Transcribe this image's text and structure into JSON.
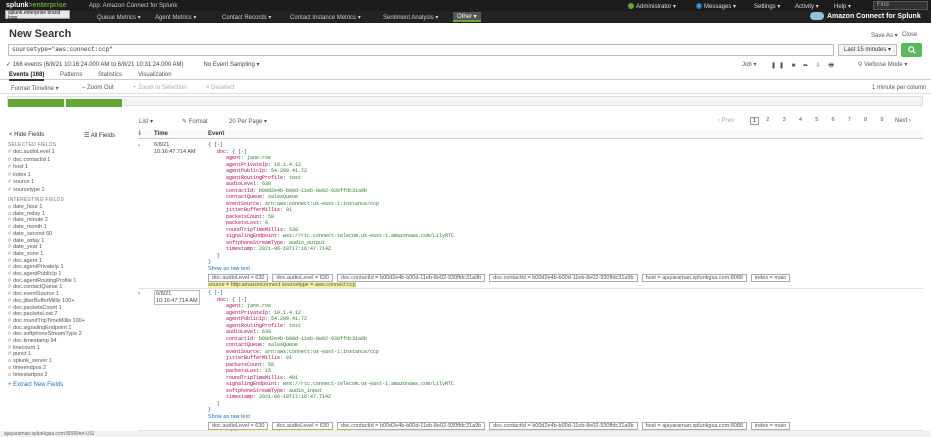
{
  "topbar": {
    "logo_main": "splunk",
    "logo_sub": ">enterprise",
    "app_title": "App: Amazon Connect for Splunk",
    "admin": "Administrator",
    "messages_count": "2",
    "messages": "Messages",
    "settings": "Settings",
    "activity": "Activity",
    "help": "Help",
    "find": "Find"
  },
  "appbar": {
    "tooltip": "splunk.enterprise brand logo",
    "nav": [
      "Queue Metrics",
      "Agent Metrics",
      "Contact Records",
      "Contact Instance Metrics",
      "Sentiment Analysis",
      "Other"
    ],
    "brand": "Amazon Connect for Splunk"
  },
  "header": {
    "title": "New Search",
    "save_as": "Save As",
    "close": "Close"
  },
  "search": {
    "query": "sourcetype=\"aws:connect:ccp\"",
    "time_range": "Last 15 minutes",
    "search_icon": "search-icon"
  },
  "status": {
    "events": "✓ 168 events (6/8/21 10:16:24.000 AM to 6/8/21 10:31:24.000 AM)",
    "sampling": "No Event Sampling",
    "job": "Job",
    "mode": "Verbose Mode"
  },
  "tabs": [
    "Events (168)",
    "Patterns",
    "Statistics",
    "Visualization"
  ],
  "timeline_bar": {
    "format": "Format Timeline",
    "zoom_out": "– Zoom Out",
    "zoom_sel": "+ Zoom to Selection",
    "deselect": "× Deselect",
    "per": "1 minute per column"
  },
  "sidebar": {
    "hide": "< Hide Fields",
    "all": "All Fields",
    "selected_header": "SELECTED FIELDS",
    "selected": [
      "doc.audioLevel 1",
      "doc.contactId 1",
      "host 1",
      "index 1",
      "source 1",
      "sourcetype 1"
    ],
    "interesting_header": "INTERESTING FIELDS",
    "interesting": [
      "date_hour 1",
      "date_mday 1",
      "date_minute 2",
      "date_month 1",
      "date_second 60",
      "date_wday 1",
      "date_year 1",
      "date_zone 1",
      "doc.agent 1",
      "doc.agentPrivateIp 1",
      "doc.agentPublicIp 1",
      "doc.agentRoutingProfile 1",
      "doc.contactQueue 1",
      "doc.eventSource 1",
      "doc.jitterBufferMillis 100+",
      "doc.packetsCount 1",
      "doc.packetsLost 7",
      "doc.roundTripTimeMillis 100+",
      "doc.signalingEndpoint 1",
      "doc.softphoneStreamType 2",
      "doc.timestamp 94",
      "linecount 1",
      "punct 1",
      "splunk_server 1",
      "timeendpos 2",
      "timestartpos 2"
    ],
    "extract": "+ Extract New Fields"
  },
  "toolbar": {
    "list": "List",
    "format": "✎ Format",
    "per_page": "20 Per Page",
    "prev": "‹ Prev",
    "pages": [
      "1",
      "2",
      "3",
      "4",
      "5",
      "6",
      "7",
      "8",
      "9"
    ],
    "next": "Next ›"
  },
  "table": {
    "col_i": "i",
    "col_time": "Time",
    "col_event": "Event"
  },
  "events": [
    {
      "date": "6/8/21",
      "time": "10:16:47.714 AM",
      "lines": [
        {
          "i": 0,
          "t": "{ [-]"
        },
        {
          "i": 1,
          "k": "doc",
          "v": "{ [-]"
        },
        {
          "i": 2,
          "k": "agent",
          "v": "jane.roe"
        },
        {
          "i": 2,
          "k": "agentPrivateIp",
          "v": "10.1.4.12"
        },
        {
          "i": 2,
          "k": "agentPublicIp",
          "v": "54.209.41.72"
        },
        {
          "i": 2,
          "k": "agentRoutingProfile",
          "v": "test"
        },
        {
          "i": 2,
          "k": "audioLevel",
          "v": "630"
        },
        {
          "i": 2,
          "k": "contactId",
          "v": "b00d2e4b-b00d-11eb-8e02-930ffdc31a9b"
        },
        {
          "i": 2,
          "k": "contactQueue",
          "v": "salesQueue"
        },
        {
          "i": 2,
          "k": "eventSource",
          "v": "arn:aws:connect:us-east-1:instance/ccp"
        },
        {
          "i": 2,
          "k": "jitterBufferMillis",
          "v": "91"
        },
        {
          "i": 2,
          "k": "packetsCount",
          "v": "50"
        },
        {
          "i": 2,
          "k": "packetsLost",
          "v": "0"
        },
        {
          "i": 2,
          "k": "roundTripTimeMillis",
          "v": "530"
        },
        {
          "i": 2,
          "k": "signalingEndpoint",
          "v": "wss://rtc.connect-telecom.us-east-1.amazonaws.com/LilyRTC"
        },
        {
          "i": 2,
          "k": "softphoneStreamType",
          "v": "audio_output"
        },
        {
          "i": 2,
          "k": "timestamp",
          "v": "2021-06-10T17:16:47.714Z"
        },
        {
          "i": 1,
          "t": "}"
        },
        {
          "i": 0,
          "t": "}"
        }
      ],
      "show_raw": "Show as raw text",
      "meta_top": [
        "doc.audioLevel = 630",
        "doc.audioLevel = 630",
        "doc.contactId = b00d2e4b-b00d-11eb-8e02-930ffdc31a9b",
        "doc.contactId = b00d2e4b-b00d-11eb-8e02-930ffdc31a9b",
        "host = ajayaraman.splunkgsa.com:8088",
        "index = main"
      ],
      "meta_bottom": "source = http:amazonconnect    sourcetype = aws:connect:ccp"
    },
    {
      "date": "6/8/21",
      "time": "10:16:47.714 AM",
      "lines": [
        {
          "i": 0,
          "t": "{ [-]"
        },
        {
          "i": 1,
          "k": "doc",
          "v": "{ [-]"
        },
        {
          "i": 2,
          "k": "agent",
          "v": "jane.roe"
        },
        {
          "i": 2,
          "k": "agentPrivateIp",
          "v": "10.1.4.12"
        },
        {
          "i": 2,
          "k": "agentPublicIp",
          "v": "54.209.41.72"
        },
        {
          "i": 2,
          "k": "agentRoutingProfile",
          "v": "test"
        },
        {
          "i": 2,
          "k": "audioLevel",
          "v": "630"
        },
        {
          "i": 2,
          "k": "contactId",
          "v": "b00d2e4b-b00d-11eb-8e02-930ffdc31a9b"
        },
        {
          "i": 2,
          "k": "contactQueue",
          "v": "salesQueue"
        },
        {
          "i": 2,
          "k": "eventSource",
          "v": "arn:aws:connect:us-east-1:instance/ccp"
        },
        {
          "i": 2,
          "k": "jitterBufferMillis",
          "v": "91"
        },
        {
          "i": 2,
          "k": "packetsCount",
          "v": "50"
        },
        {
          "i": 2,
          "k": "packetsLost",
          "v": "15"
        },
        {
          "i": 2,
          "k": "roundTripTimeMillis",
          "v": "491"
        },
        {
          "i": 2,
          "k": "signalingEndpoint",
          "v": "wss://rtc.connect-telecom.us-east-1.amazonaws.com/LilyRTC"
        },
        {
          "i": 2,
          "k": "softphoneStreamType",
          "v": "audio_input"
        },
        {
          "i": 2,
          "k": "timestamp",
          "v": "2021-06-10T17:16:47.714Z"
        },
        {
          "i": 1,
          "t": "}"
        },
        {
          "i": 0,
          "t": "}"
        }
      ],
      "show_raw": "Show as raw text",
      "meta_top": [
        "doc.audioLevel = 630",
        "doc.audioLevel = 630",
        "doc.contactId = b00d2e4b-b00d-11eb-8e02-930ffdc31a9b",
        "doc.contactId = b00d2e4b-b00d-11eb-8e02-930ffdc31a9b",
        "host = ajayaraman.splunkgsa.com:8088",
        "index = main"
      ],
      "meta_bottom": "source = http:amazonconnect    sourcetype = aws:connect:ccp"
    }
  ],
  "statusbar": "ajayaraman.splunkgsa.com:8000/en-US/"
}
